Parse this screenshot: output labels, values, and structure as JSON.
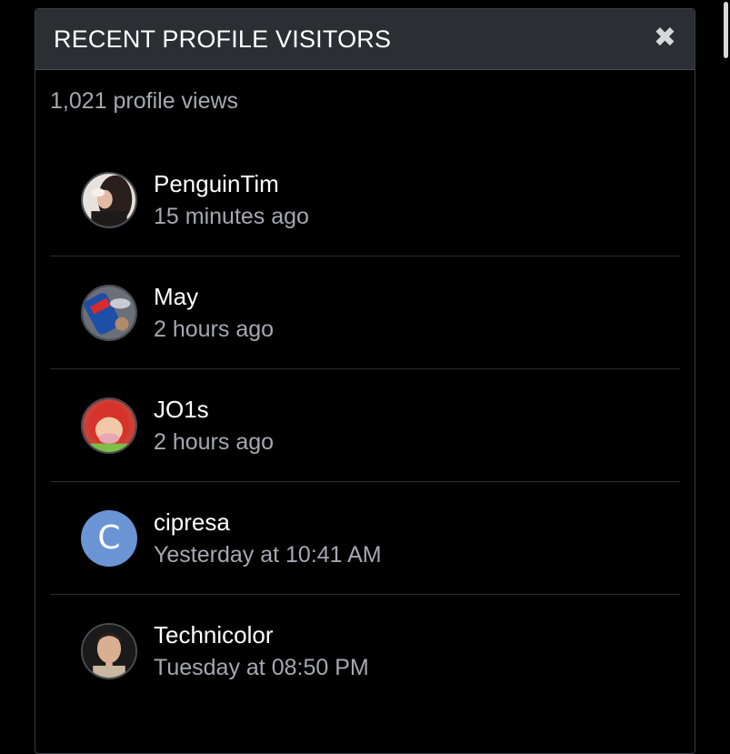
{
  "modal": {
    "title": "RECENT PROFILE VISITORS",
    "close_glyph": "✖",
    "views_count": "1,021 profile views"
  },
  "visitors": [
    {
      "name": "PenguinTim",
      "time": "15 minutes ago",
      "avatar": "photo-portrait"
    },
    {
      "name": "May",
      "time": "2 hours ago",
      "avatar": "photo-can"
    },
    {
      "name": "JO1s",
      "time": "2 hours ago",
      "avatar": "photo-cartoon"
    },
    {
      "name": "cipresa",
      "time": "Yesterday at 10:41 AM",
      "avatar": "letter",
      "avatar_letter": "C",
      "avatar_color": "#6a94d4"
    },
    {
      "name": "Technicolor",
      "time": "Tuesday at 08:50 PM",
      "avatar": "photo-man"
    }
  ],
  "colors": {
    "background": "#000000",
    "header": "#2b2e33",
    "muted_text": "#a4a8b0"
  }
}
